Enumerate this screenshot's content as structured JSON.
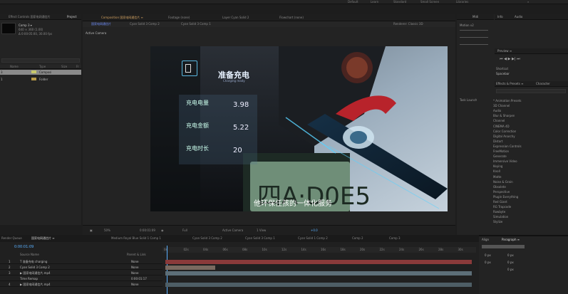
{
  "topbar": {
    "items": [
      "Default",
      "Learn",
      "Standard",
      "Small Screen",
      "Libraries"
    ]
  },
  "project": {
    "tabs": [
      "Effect Controls 国家电网通信片",
      "Project"
    ],
    "comp_name": "Comp 3 ▾",
    "info_lines": [
      "640 × 360 (1.00)",
      "Δ 0:00:05:00, 30.00 fps"
    ],
    "columns": [
      "Name",
      "Type",
      "Size",
      "Fr"
    ],
    "rows": [
      {
        "num": "3",
        "type": "Composi"
      },
      {
        "num": "1",
        "type": "Folder"
      }
    ]
  },
  "viewer": {
    "tabs": [
      "Composition 国家电网通信片 ≡",
      "Footage (none)",
      "Layer Cyan Solid 2",
      "Flowchart (none)"
    ],
    "subtabs": [
      "国家电网通信片",
      "Cyan Solid 3 Comp 2",
      "Cyan Solid 3 Comp 1"
    ],
    "label": "Active Camera",
    "renderer": "Renderer: Classic 3D",
    "overlay": {
      "title": "准备充电",
      "subtitle": "Charging ready",
      "rows": [
        {
          "label": "充电电量",
          "value": "3.98"
        },
        {
          "label": "充电金额",
          "value": "5.22"
        },
        {
          "label": "充电时长",
          "value": "20"
        }
      ],
      "caption": "他环保任孩的一体化服务"
    },
    "toolbar": {
      "zoom": "50%",
      "timecode": "0:00:01:09",
      "resolution": "Full",
      "camera": "Active Camera",
      "view": "1 View",
      "offset": "+0.0"
    }
  },
  "right": {
    "tabs_top": [
      "Info",
      "Audio"
    ],
    "tracker_tab": "Motion v2",
    "preview_tab": "Preview ≡",
    "shortcut_label": "Shortcut",
    "shortcut_value": "Spacebar",
    "effects_tab": "Effects & Presets ≡",
    "character_tab": "Character",
    "track_label": "Task Launch",
    "effects": [
      "* Animation Presets",
      "3D Channel",
      "Audio",
      "Blur & Sharpen",
      "Channel",
      "CINEMA 4D",
      "Color Correction",
      "Digital Anarchy",
      "Distort",
      "Expression Controls",
      "FreeMotion",
      "Generate",
      "Immersive Video",
      "Keying",
      "Knoll",
      "Matte",
      "Noise & Grain",
      "Obsolete",
      "Perspective",
      "Plugin Everything",
      "Red Giant",
      "RG Trapcode",
      "Rowbyte",
      "Simulation",
      "Stylize"
    ]
  },
  "timeline": {
    "tabs": [
      "Render Queue",
      "国家电网通信片 ≡",
      "Medium Royal Blue Solid 1 Comp 1",
      "Cyan Solid 3 Comp 2",
      "Cyan Solid 3 Comp 1",
      "Cyan Solid 1 Comp 2",
      "Comp 2",
      "Comp 3"
    ],
    "timecode": "0:00:01:09",
    "columns": [
      "Source Name",
      "Parent & Link"
    ],
    "ruler": [
      "0s",
      "02s",
      "04s",
      "06s",
      "08s",
      "10s",
      "12s",
      "14s",
      "16s",
      "18s",
      "20s",
      "22s",
      "24s",
      "26s",
      "28s",
      "30s"
    ],
    "layers": [
      {
        "num": "1",
        "name": "T  准备充电 charging",
        "parent": "None"
      },
      {
        "num": "2",
        "name": "Cyan Solid 3 Comp 2",
        "parent": "None"
      },
      {
        "num": "3",
        "name": "▶ 国家电网通信片.mp4",
        "parent": "None"
      },
      {
        "num": "",
        "name": "Time Remap",
        "parent": "0:00:01:17"
      },
      {
        "num": "4",
        "name": "▶ 国家电网通信片.mp4",
        "parent": "None"
      }
    ],
    "right_tabs": [
      "Align",
      "Paragraph ≡"
    ],
    "para_values": [
      "0 px",
      "0 px",
      "0 px",
      "0 px",
      "0 px"
    ]
  }
}
